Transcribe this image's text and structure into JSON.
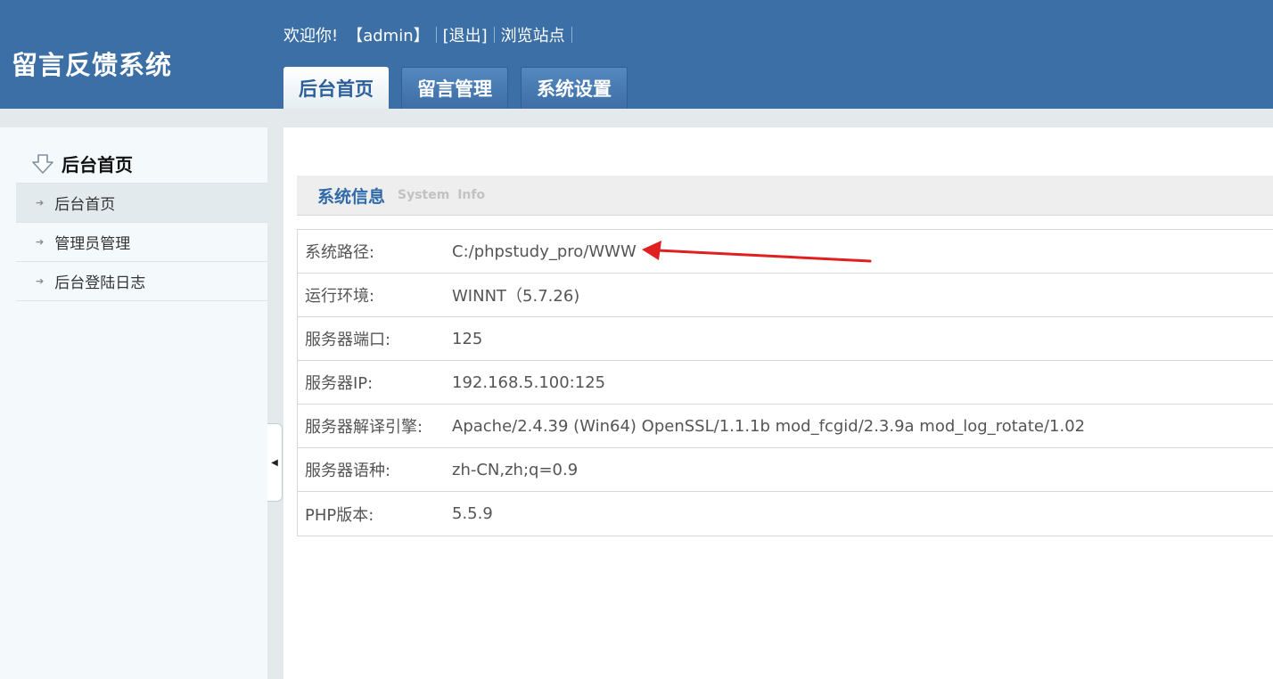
{
  "app": {
    "title": "留言反馈系统"
  },
  "topbar": {
    "welcome": "欢迎你!",
    "user": "【admin】",
    "logout": "[退出]",
    "browse": "浏览站点"
  },
  "tabs": [
    {
      "label": "后台首页",
      "active": true
    },
    {
      "label": "留言管理",
      "active": false
    },
    {
      "label": "系统设置",
      "active": false
    }
  ],
  "sidebar": {
    "heading": "后台首页",
    "heading_icon": "down-arrow-outline-icon",
    "items": [
      {
        "label": "后台首页",
        "selected": true
      },
      {
        "label": "管理员管理",
        "selected": false
      },
      {
        "label": "后台登陆日志",
        "selected": false
      }
    ]
  },
  "main": {
    "section_title": "系统信息",
    "section_subtitle": "System  Info",
    "rows": [
      {
        "label": "系统路径:",
        "value": "C:/phpstudy_pro/WWW"
      },
      {
        "label": "运行环境:",
        "value": "WINNT（5.7.26)"
      },
      {
        "label": "服务器端口:",
        "value": "125"
      },
      {
        "label": "服务器IP:",
        "value": "192.168.5.100:125"
      },
      {
        "label": "服务器解译引擎:",
        "value": "Apache/2.4.39 (Win64) OpenSSL/1.1.1b mod_fcgid/2.3.9a mod_log_rotate/1.02"
      },
      {
        "label": "服务器语种:",
        "value": "zh-CN,zh;q=0.9"
      },
      {
        "label": "PHP版本:",
        "value": "5.5.9"
      }
    ]
  },
  "colors": {
    "header_bg": "#3b6fa6",
    "accent_text": "#2f6aa8",
    "annotation_arrow": "#e02020"
  }
}
